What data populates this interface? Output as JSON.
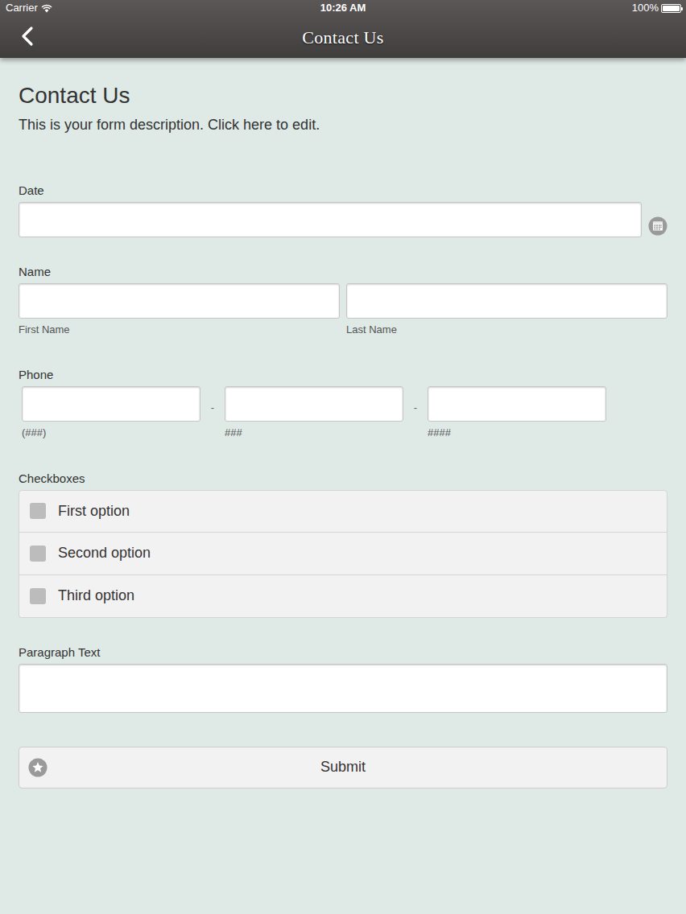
{
  "status_bar": {
    "carrier": "Carrier",
    "time": "10:26 AM",
    "battery": "100%",
    "battery_level": 1
  },
  "nav_bar": {
    "title": "Contact Us"
  },
  "form": {
    "title": "Contact Us",
    "description": "This is your form description. Click here to edit.",
    "fields": [
      {
        "kind": "date",
        "label": "Date"
      },
      {
        "kind": "name",
        "label": "Name",
        "hints": [
          "First Name",
          "Last Name"
        ]
      },
      {
        "kind": "phone",
        "label": "Phone",
        "hints": [
          "(###)",
          "###",
          "####"
        ],
        "separators": [
          "-",
          "-"
        ]
      },
      {
        "kind": "checkboxes",
        "label": "Checkboxes",
        "options": [
          {
            "label": "First option",
            "checked": false
          },
          {
            "label": "Second option",
            "checked": false
          },
          {
            "label": "Third option",
            "checked": false
          }
        ]
      },
      {
        "kind": "paragraph",
        "label": "Paragraph Text"
      }
    ],
    "submit": {
      "label": "Submit"
    }
  }
}
